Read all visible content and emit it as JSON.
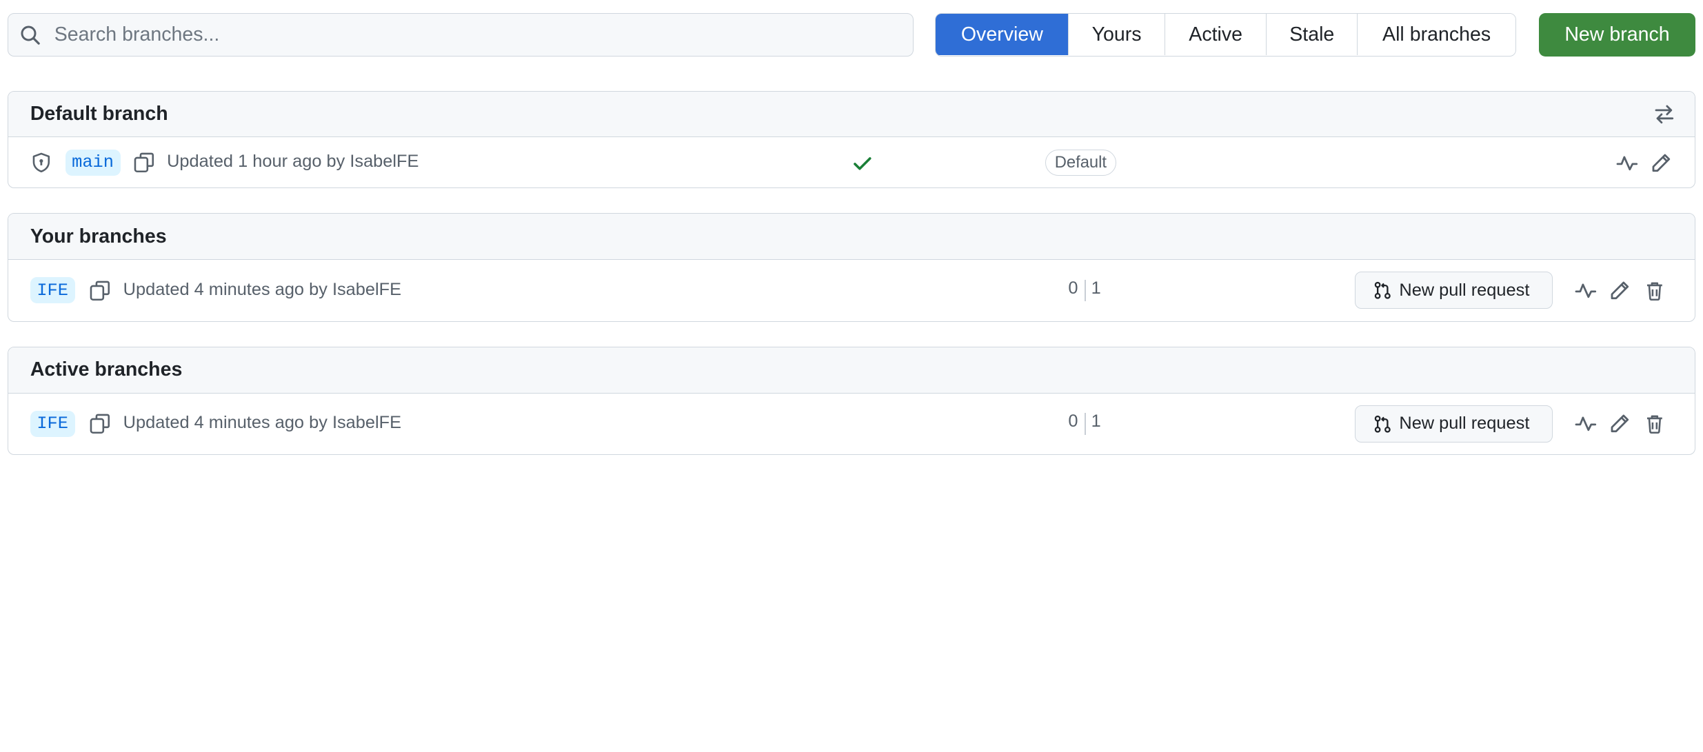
{
  "search": {
    "placeholder": "Search branches..."
  },
  "filters": {
    "tabs": [
      {
        "label": "Overview",
        "active": true
      },
      {
        "label": "Yours",
        "active": false
      },
      {
        "label": "Active",
        "active": false
      },
      {
        "label": "Stale",
        "active": false
      },
      {
        "label": "All branches",
        "active": false
      }
    ]
  },
  "new_branch_label": "New branch",
  "default_section": {
    "title": "Default branch",
    "branch": {
      "name": "main",
      "updated": "Updated 1 hour ago by IsabelFE",
      "status": "success",
      "badge": "Default"
    }
  },
  "your_section": {
    "title": "Your branches",
    "branch": {
      "name": "IFE",
      "updated": "Updated 4 minutes ago by IsabelFE",
      "behind": "0",
      "ahead": "1",
      "pr_label": "New pull request"
    }
  },
  "active_section": {
    "title": "Active branches",
    "branch": {
      "name": "IFE",
      "updated": "Updated 4 minutes ago by IsabelFE",
      "behind": "0",
      "ahead": "1",
      "pr_label": "New pull request"
    }
  },
  "colors": {
    "primary_tab": "#2f6ed6",
    "new_branch": "#3e8a3f",
    "branch_chip_bg": "#ddf4ff",
    "branch_chip_fg": "#0969da",
    "success": "#1a7f37"
  },
  "icons": [
    "search-icon",
    "arrows-swap-icon",
    "shield-icon",
    "copy-icon",
    "check-icon",
    "pull-request-icon",
    "activity-icon",
    "pencil-icon",
    "trash-icon"
  ]
}
